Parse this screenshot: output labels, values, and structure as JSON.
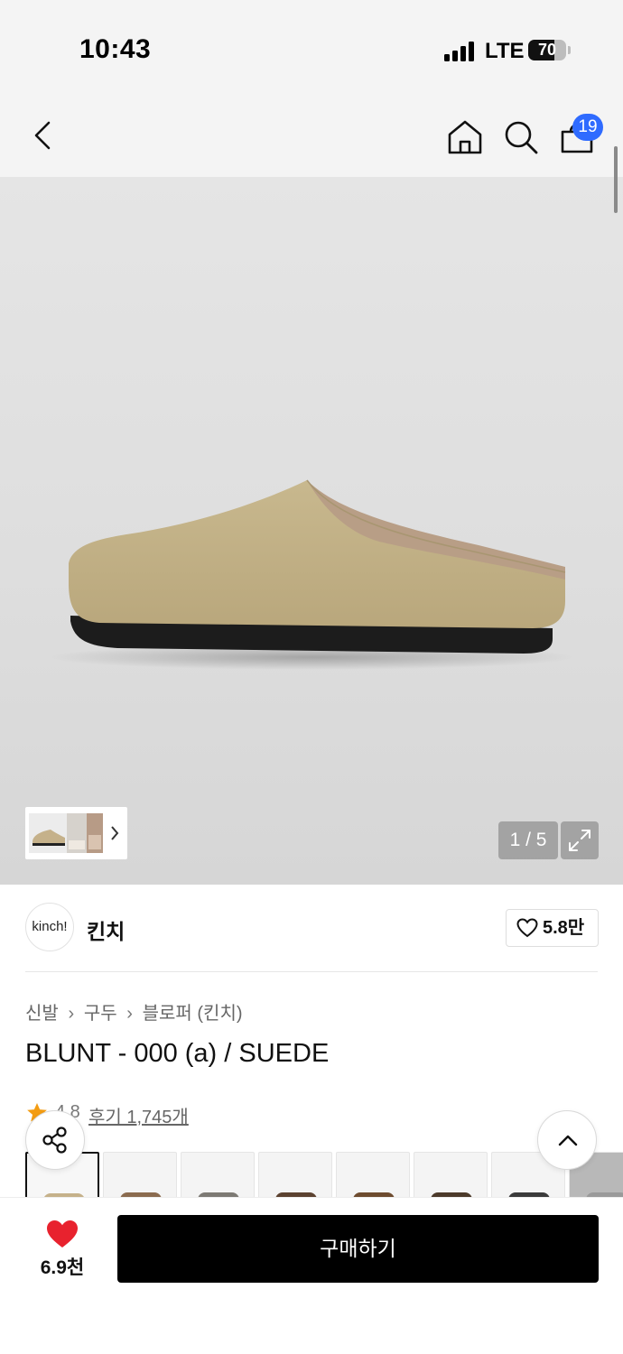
{
  "status_bar": {
    "time": "10:43",
    "network": "LTE",
    "battery_level": "70"
  },
  "nav": {
    "cart_count": "19"
  },
  "gallery": {
    "counter": "1 / 5"
  },
  "brand": {
    "logo_text": "kinch!",
    "name": "킨치",
    "like_count": "5.8만"
  },
  "breadcrumb": {
    "items": [
      "신발",
      "구두",
      "블로퍼 (킨치)"
    ]
  },
  "product": {
    "title": "BLUNT - 000 (a) / SUEDE",
    "rating": "4.8",
    "review_label": "후기 1,745개"
  },
  "bottom_bar": {
    "wish_count": "6.9천",
    "buy_label": "구매하기"
  },
  "colors": {
    "accent_blue": "#2f6bff",
    "heart_red": "#e8222e",
    "star_orange": "#f39c12",
    "buy_button": "#000000"
  }
}
